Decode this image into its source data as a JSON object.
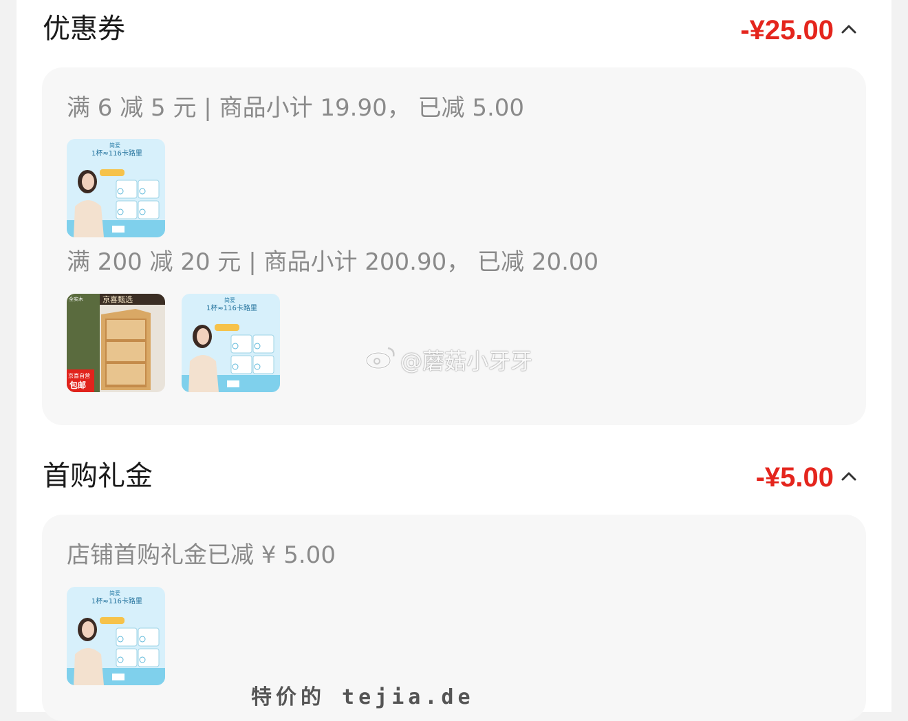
{
  "coupon_section": {
    "title": "优惠券",
    "amount": "-¥25.00",
    "groups": [
      {
        "desc": "满 6 减 5 元 | 商品小计 19.90， 已减 5.00",
        "items": [
          {
            "type": "yogurt",
            "header": "1杯≈116卡路里"
          }
        ]
      },
      {
        "desc": "满 200 减 20 元 | 商品小计 200.90， 已减 20.00",
        "items": [
          {
            "type": "shelf",
            "tag": "京喜甄选",
            "badge1": "京喜自营",
            "badge2": "包邮",
            "corner": "全实木"
          },
          {
            "type": "yogurt",
            "header": "1杯≈116卡路里"
          }
        ]
      }
    ]
  },
  "first_purchase_section": {
    "title": "首购礼金",
    "amount": "-¥5.00",
    "desc": "店铺首购礼金已减 ¥ 5.00",
    "items": [
      {
        "type": "yogurt",
        "header": "1杯≈116卡路里"
      }
    ]
  },
  "watermarks": {
    "weibo": "@蘑菇小牙牙",
    "site": "特价的 tejia.de"
  },
  "colors": {
    "accent": "#e4251d",
    "panel_bg": "#f7f7f7",
    "yogurt_bg": "#d7f0fb"
  }
}
